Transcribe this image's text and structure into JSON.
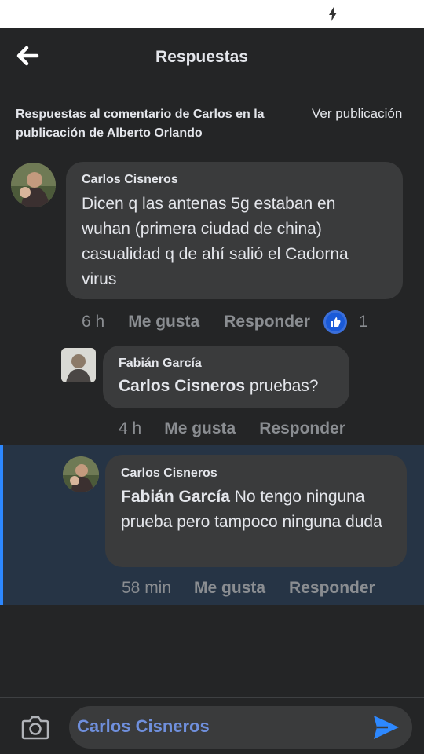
{
  "header": {
    "title": "Respuestas",
    "back_icon": "arrow-left-icon"
  },
  "context": {
    "text": "Respuestas al comentario de Carlos en la publicación de Alberto Orlando",
    "view_post": "Ver publicación"
  },
  "comments": [
    {
      "author": "Carlos Cisneros",
      "text": "Dicen q las antenas 5g estaban en wuhan (primera ciudad de china) casualidad q de ahí salió el Cadorna virus",
      "time": "6 h",
      "like_label": "Me gusta",
      "reply_label": "Responder",
      "reactions": "1"
    },
    {
      "author": "Fabián García",
      "mention": "Carlos Cisneros",
      "text": " pruebas?",
      "time": "4 h",
      "like_label": "Me gusta",
      "reply_label": "Responder"
    },
    {
      "author": "Carlos Cisneros",
      "mention": "Fabián García",
      "text": " No tengo ninguna prueba pero tampoco ninguna duda",
      "time": "58 min",
      "like_label": "Me gusta",
      "reply_label": "Responder"
    }
  ],
  "composer": {
    "value": "Carlos Cisneros",
    "camera_icon": "camera-icon",
    "send_icon": "send-icon"
  },
  "colors": {
    "background": "#242526",
    "bubble": "#3a3b3c",
    "highlight": "#263445",
    "accent": "#2d88ff"
  }
}
